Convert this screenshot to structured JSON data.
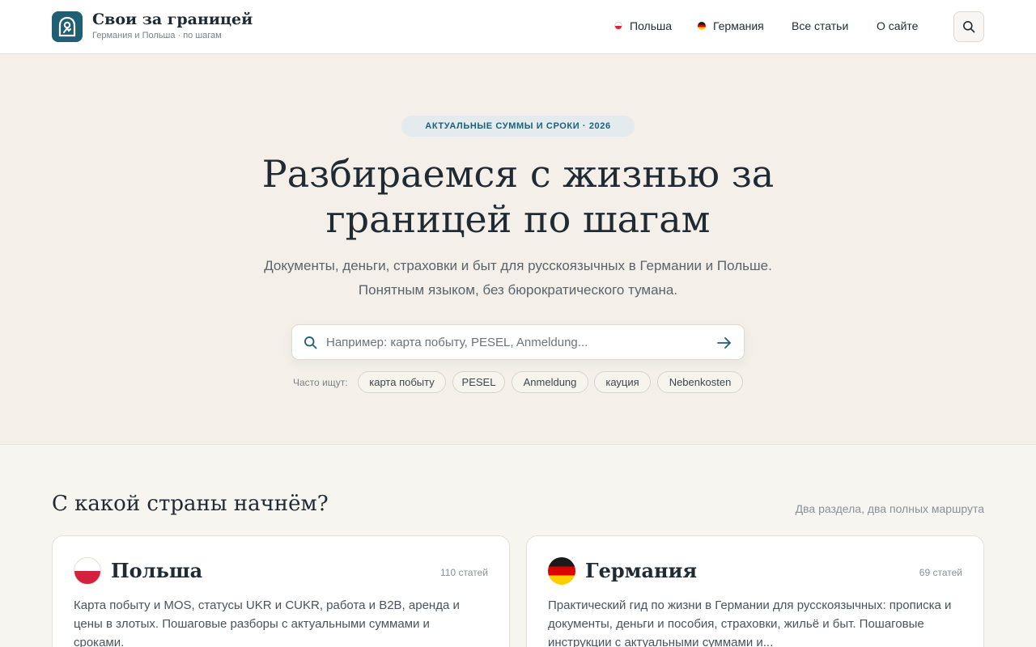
{
  "header": {
    "brand_title": "Свои за границей",
    "brand_subtitle": "Германия и Польша · по шагам",
    "nav": [
      {
        "label": "Польша",
        "flag": "poland-flag-icon"
      },
      {
        "label": "Германия",
        "flag": "germany-flag-icon"
      },
      {
        "label": "Все статьи"
      },
      {
        "label": "О сайте"
      }
    ],
    "search_icon": "search-icon"
  },
  "hero": {
    "badge": "АКТУАЛЬНЫЕ СУММЫ И СРОКИ · 2026",
    "title": "Разбираемся с жизнью за границей по шагам",
    "subtitle": "Документы, деньги, страховки и быт для русскоязычных в Германии и Польше. Понятным языком, без бюрократического тумана.",
    "search": {
      "placeholder": "Например: карта побыту, PESEL, Anmeldung...",
      "value": ""
    },
    "popular_label": "Часто ищут:",
    "popular": [
      "карта побыту",
      "PESEL",
      "Anmeldung",
      "кауция",
      "Nebenkosten"
    ]
  },
  "countries": {
    "title": "С какой страны начнём?",
    "hint": "Два раздела, два полных маршрута",
    "cards": [
      {
        "name": "Польша",
        "count": "110 статей",
        "description": "Карта побыту и MOS, статусы UKR и CUKR, работа и B2B, аренда и цены в злотых. Пошаговые разборы с актуальными суммами и сроками."
      },
      {
        "name": "Германия",
        "count": "69 статей",
        "description": "Практический гид по жизни в Германии для русскоязычных: прописка и документы, деньги и пособия, страховки, жильё и быт. Пошаговые инструкции с актуальными суммами и..."
      }
    ]
  },
  "colors": {
    "accent": "#1e5f74",
    "hero_bg": "#f4f0e9",
    "page_bg": "#f7f5f0",
    "badge_bg": "#e3ebef"
  }
}
